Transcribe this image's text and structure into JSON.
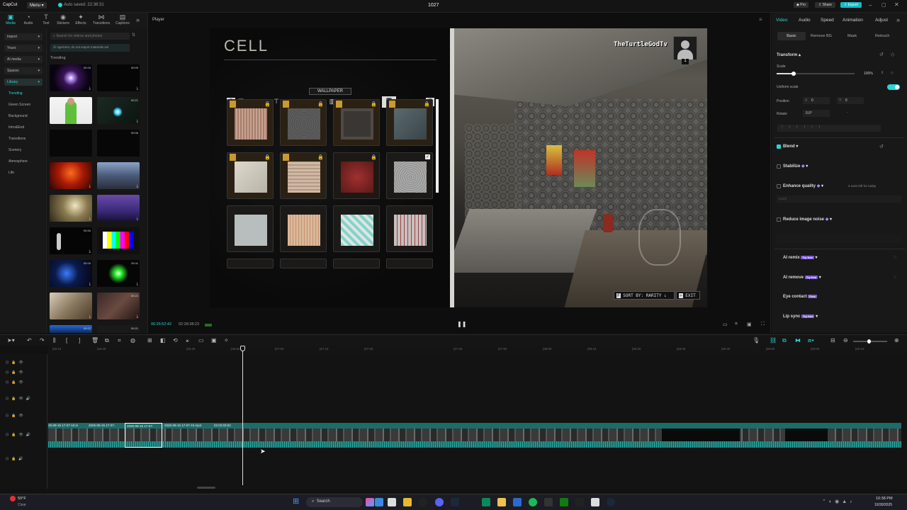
{
  "titlebar": {
    "app_name": "CapCut",
    "menu_label": "Menu",
    "autosave": "Auto saved: 22:38:31",
    "project_title": "1027",
    "pro_label": "Pro",
    "share_label": "Share",
    "export_label": "Export"
  },
  "media_tools": [
    {
      "label": "Media",
      "icon": "media-icon"
    },
    {
      "label": "Audio",
      "icon": "audio-icon"
    },
    {
      "label": "Text",
      "icon": "text-icon"
    },
    {
      "label": "Stickers",
      "icon": "stickers-icon"
    },
    {
      "label": "Effects",
      "icon": "effects-icon"
    },
    {
      "label": "Transitions",
      "icon": "transitions-icon"
    },
    {
      "label": "Captions",
      "icon": "captions-icon"
    }
  ],
  "leftnav": {
    "import": "Import",
    "yours": "Yours",
    "ai_media": "AI media",
    "spaces": "Spaces",
    "library": "Library",
    "items": [
      "Trending",
      "Green Screen",
      "Background",
      "Intro&End",
      "Transitions",
      "Scenery",
      "Atmosphere",
      "Life"
    ]
  },
  "mediapanel": {
    "search_placeholder": "Search for videos and photos",
    "notice": "ngement, do not export materials wit",
    "section": "Trending",
    "durations": [
      "00:15",
      "00:09",
      "00:21",
      "00:06",
      "00:34",
      "00:16",
      "00:11",
      "00:21",
      "00:22",
      "00:21"
    ]
  },
  "player": {
    "label": "Player",
    "time_current": "00:26:52:42",
    "time_total": "02:28:38:23",
    "overlay": {
      "title": "CELL",
      "category": "WALLPAPER",
      "channel": "TheTurtleGodTv",
      "player_count": "1",
      "sort": "SORT BY: RARITY",
      "exit": "EXIT"
    }
  },
  "rightpanel": {
    "tabs": [
      "Video",
      "Audio",
      "Speed",
      "Animation",
      "Adjust"
    ],
    "subtabs": [
      "Basic",
      "Remove BG",
      "Mask",
      "Retouch"
    ],
    "transform": "Transform",
    "scale": "Scale",
    "scale_value": "100%",
    "uniform_scale": "Uniform scale",
    "position": "Position",
    "pos_x_label": "X",
    "pos_x": "0",
    "pos_y_label": "Y",
    "pos_y": "0",
    "rotate": "Rotate",
    "rotate_value": "0.0°",
    "rotate_dash": "-",
    "sections": [
      "Blend",
      "Stabilize",
      "Enhance quality",
      "Reduce image noise",
      "AI remix",
      "AI remove",
      "Eye contact",
      "Lip sync"
    ],
    "enhance_note": "3 uses left for today",
    "enhance_level": "Level",
    "try_free": "Try free",
    "free": "Free"
  },
  "timeline": {
    "ruler": [
      "|26:10",
      "|26:20",
      "|26:40",
      "|26:50",
      "|27:00",
      "|27:10",
      "|27:20",
      "|27:40",
      "|27:50",
      "|28:00",
      "|28:10",
      "|28:20",
      "|28:30",
      "|28:40",
      "|28:50",
      "|29:00",
      "|29:10"
    ],
    "clips": [
      "25-09-15 17-07-10.m",
      "2025-09-15 17-07-",
      "2025-09-15 17-07-",
      "2025-09-15 17-07-10.mp4",
      "02:02:03:52"
    ]
  },
  "taskbar": {
    "weather_temp": "50°F",
    "weather_desc": "Clear",
    "search": "Search",
    "time": "10:38 PM",
    "date": "10/30/2025"
  },
  "colors": {
    "accent": "#2bd4d4",
    "export": "#17b9c7",
    "clip": "#1c6c6a"
  }
}
